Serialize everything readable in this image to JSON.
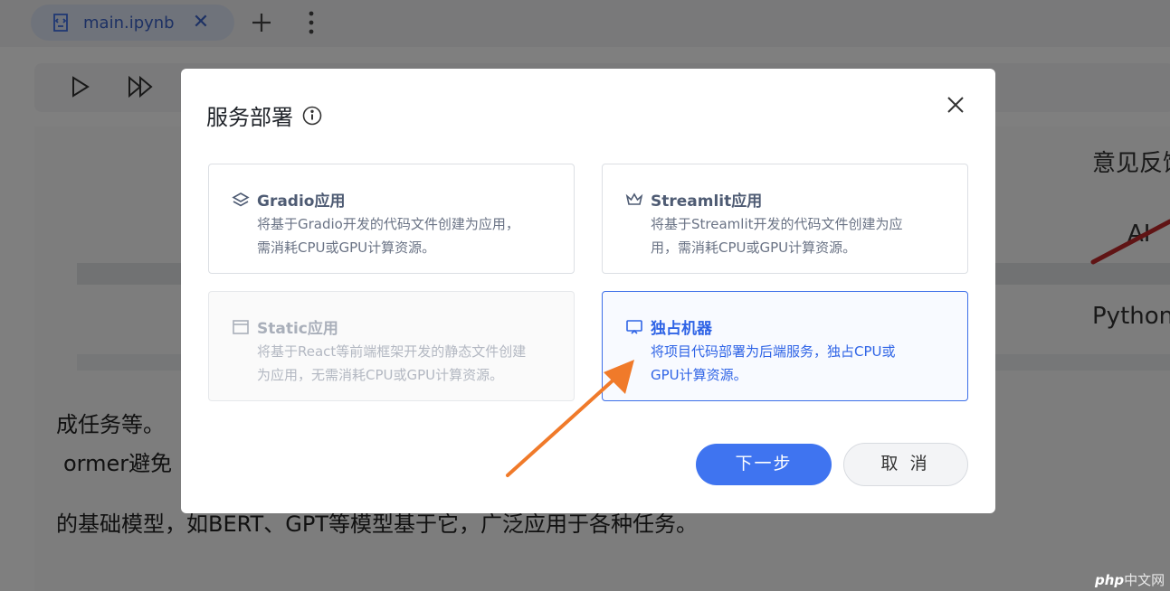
{
  "tab": {
    "title": "main.ipynb",
    "close_glyph": "✕"
  },
  "background": {
    "line1": "成任务等。",
    "line2": "ormer避免",
    "line3": "的基础模型，如BERT、GPT等模型基于它，广泛应用于各种任务。",
    "right1": "意见反馈",
    "right2": "AI",
    "right3": "Python"
  },
  "modal": {
    "title": "服务部署",
    "cards": [
      {
        "id": "gradio",
        "title": "Gradio应用",
        "desc": "将基于Gradio开发的代码文件创建为应用，需消耗CPU或GPU计算资源。",
        "state": "normal",
        "icon": "layers-icon"
      },
      {
        "id": "streamlit",
        "title": "Streamlit应用",
        "desc": "将基于Streamlit开发的代码文件创建为应用，需消耗CPU或GPU计算资源。",
        "state": "normal",
        "icon": "crown-icon"
      },
      {
        "id": "static",
        "title": "Static应用",
        "desc": "将基于React等前端框架开发的静态文件创建为应用，无需消耗CPU或GPU计算资源。",
        "state": "disabled",
        "icon": "window-icon"
      },
      {
        "id": "dedicated",
        "title": "独占机器",
        "desc": "将项目代码部署为后端服务，独占CPU或GPU计算资源。",
        "state": "selected",
        "icon": "monitor-icon"
      }
    ],
    "next_label": "下一步",
    "cancel_label": "取 消"
  },
  "watermark": {
    "brand": "php",
    "site": "中文网"
  },
  "colors": {
    "primary": "#3f74f0",
    "selected_text": "#2f64e6",
    "arrow_orange": "#f07a2a",
    "arrow_red": "#c0282a"
  }
}
